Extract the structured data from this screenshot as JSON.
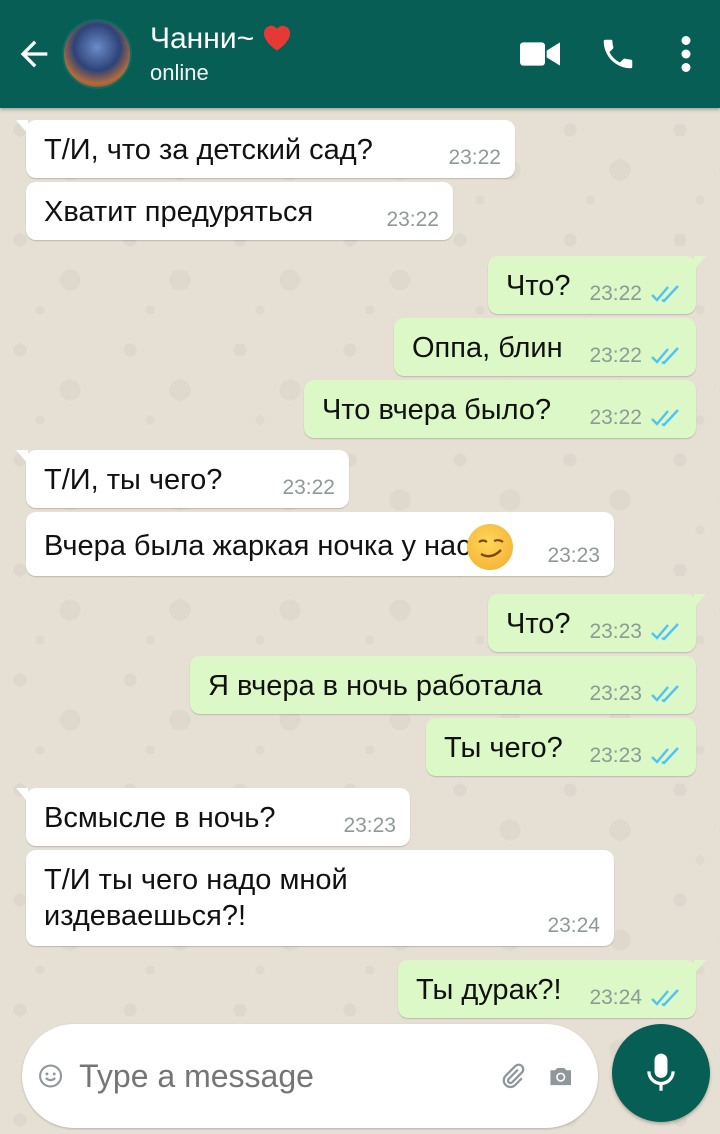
{
  "header": {
    "contact_name": "Чанни~",
    "status": "online"
  },
  "messages": [
    {
      "dir": "in",
      "text": "Т/И, что за детский сад?",
      "time": "23:22"
    },
    {
      "dir": "in",
      "text": "Хватит предуряться",
      "time": "23:22"
    },
    {
      "dir": "out",
      "text": "Что?",
      "time": "23:22",
      "read": true
    },
    {
      "dir": "out",
      "text": "Оппа, блин",
      "time": "23:22",
      "read": true
    },
    {
      "dir": "out",
      "text": "Что вчера было?",
      "time": "23:22",
      "read": true
    },
    {
      "dir": "in",
      "text": "Т/И, ты чего?",
      "time": "23:22"
    },
    {
      "dir": "in",
      "text": "Вчера была жаркая ночка у нас",
      "time": "23:23",
      "emoji": "smirking-face"
    },
    {
      "dir": "out",
      "text": "Что?",
      "time": "23:23",
      "read": true
    },
    {
      "dir": "out",
      "text": "Я вчера в ночь работала",
      "time": "23:23",
      "read": true
    },
    {
      "dir": "out",
      "text": "Ты чего?",
      "time": "23:23",
      "read": true
    },
    {
      "dir": "in",
      "text": "Всмысле в ночь?",
      "time": "23:23"
    },
    {
      "dir": "in",
      "text": "Т/И ты чего надо мной\nиздеваешься?!",
      "time": "23:24"
    },
    {
      "dir": "out",
      "text": "Ты дурак?!",
      "time": "23:24",
      "read": true
    }
  ],
  "composer": {
    "placeholder": "Type a message"
  },
  "colors": {
    "header": "#075e54",
    "incoming": "#ffffff",
    "outgoing": "#dcf8c6",
    "read_ticks": "#4fc3f7"
  }
}
